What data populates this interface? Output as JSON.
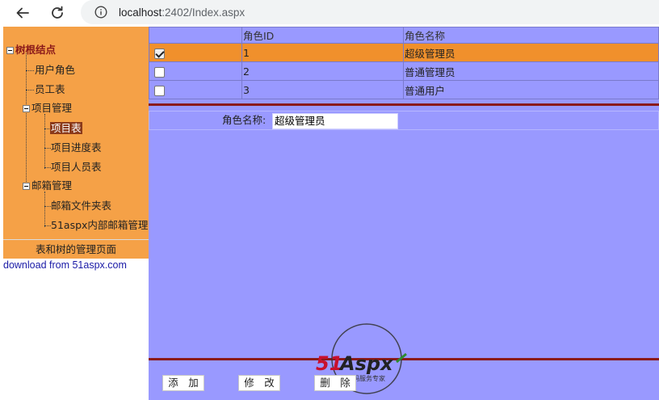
{
  "browser": {
    "url_host": "localhost",
    "url_rest": ":2402/Index.aspx"
  },
  "tree": {
    "root": "树根结点",
    "items": [
      {
        "label": "用户角色"
      },
      {
        "label": "员工表"
      },
      {
        "label": "项目管理"
      },
      {
        "label": "项目表",
        "selected": true
      },
      {
        "label": "项目进度表"
      },
      {
        "label": "项目人员表"
      },
      {
        "label": "邮箱管理"
      },
      {
        "label": "邮箱文件夹表"
      },
      {
        "label": "51aspx内部邮箱管理"
      }
    ],
    "caption": "表和树的管理页面",
    "credit": "download from 51aspx.com"
  },
  "grid": {
    "headers": [
      "",
      "角色ID",
      "角色名称"
    ],
    "rows": [
      {
        "checked": true,
        "id": "1",
        "name": "超级管理员"
      },
      {
        "checked": false,
        "id": "2",
        "name": "普通管理员"
      },
      {
        "checked": false,
        "id": "3",
        "name": "普通用户"
      }
    ]
  },
  "form": {
    "label": "角色名称:",
    "value": "超级管理员"
  },
  "buttons": {
    "add": "添　加",
    "edit": "修　改",
    "delete": "删　除"
  },
  "watermark": {
    "brand": "51Aspx",
    "tagline": "源码服务专家"
  },
  "colors": {
    "tree_bg": "#f5a147",
    "main_bg": "#9999ff",
    "selected_row": "#f0902c",
    "divider": "#8b1a1a"
  }
}
